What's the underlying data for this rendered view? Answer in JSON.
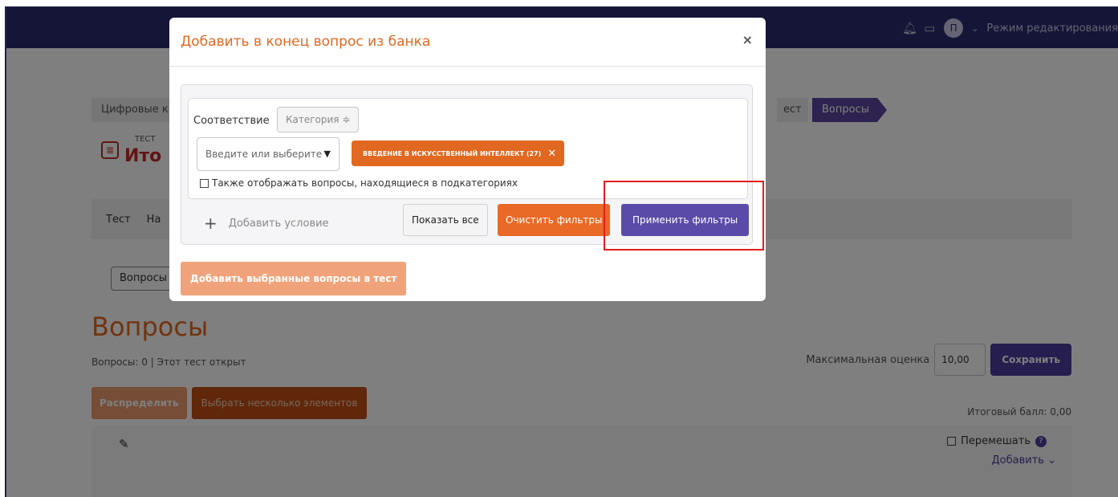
{
  "navbar": {
    "avatar_letter": "П",
    "edit_mode_label": "Режим редактирования"
  },
  "breadcrumb": {
    "first": "Цифровые к",
    "prev": "ест",
    "current": "Вопросы"
  },
  "quiz": {
    "type_label": "ТЕСТ",
    "title": "Ито"
  },
  "secondary_nav": {
    "items": [
      "Тест",
      "На"
    ]
  },
  "questions_button": "Вопросы",
  "main": {
    "heading": "Вопросы",
    "info": "Вопросы: 0 | Этот тест открыт",
    "max_grade_label": "Максимальная оценка",
    "max_grade_value": "10,00",
    "save_label": "Сохранить",
    "total_label": "Итоговый балл: 0,00",
    "distribute_label": "Распределить",
    "select_multiple_label": "Выбрать несколько элементов",
    "shuffle_label": "Перемешать",
    "add_label": "Добавить"
  },
  "modal": {
    "title": "Добавить в конец вопрос из банка",
    "close_symbol": "×",
    "condition_label": "Соответствие",
    "condition_select": "Категория ≑",
    "input_placeholder": "Введите или выберите",
    "tag_label": "ВВЕДЕНИЕ В ИСКУССТВЕННЫЙ ИНТЕЛЛЕКТ (27)",
    "subcategories_label": "Также отображать вопросы, находящиеся в подкатегориях",
    "add_condition_label": "Добавить условие",
    "show_all_label": "Показать все",
    "clear_filters_label": "Очистить фильтры",
    "apply_filters_label": "Применить фильтры",
    "add_selected_label": "Добавить выбранные вопросы в тест"
  },
  "colors": {
    "accent_orange": "#e06820",
    "accent_purple": "#5b4ba8",
    "highlight_red": "#e01e1e"
  }
}
